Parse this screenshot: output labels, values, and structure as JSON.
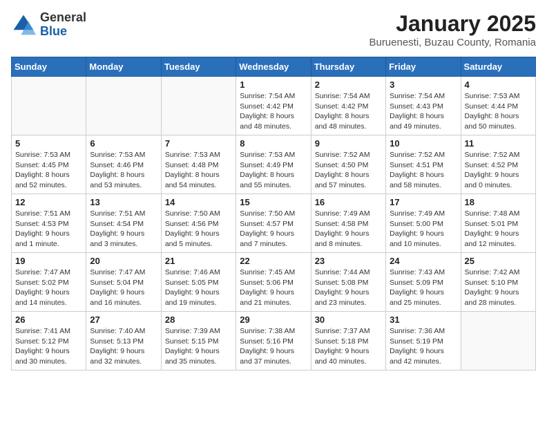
{
  "header": {
    "logo_general": "General",
    "logo_blue": "Blue",
    "month_title": "January 2025",
    "location": "Buruenesti, Buzau County, Romania"
  },
  "weekdays": [
    "Sunday",
    "Monday",
    "Tuesday",
    "Wednesday",
    "Thursday",
    "Friday",
    "Saturday"
  ],
  "weeks": [
    [
      {
        "day": "",
        "info": ""
      },
      {
        "day": "",
        "info": ""
      },
      {
        "day": "",
        "info": ""
      },
      {
        "day": "1",
        "info": "Sunrise: 7:54 AM\nSunset: 4:42 PM\nDaylight: 8 hours\nand 48 minutes."
      },
      {
        "day": "2",
        "info": "Sunrise: 7:54 AM\nSunset: 4:42 PM\nDaylight: 8 hours\nand 48 minutes."
      },
      {
        "day": "3",
        "info": "Sunrise: 7:54 AM\nSunset: 4:43 PM\nDaylight: 8 hours\nand 49 minutes."
      },
      {
        "day": "4",
        "info": "Sunrise: 7:53 AM\nSunset: 4:44 PM\nDaylight: 8 hours\nand 50 minutes."
      }
    ],
    [
      {
        "day": "5",
        "info": "Sunrise: 7:53 AM\nSunset: 4:45 PM\nDaylight: 8 hours\nand 52 minutes."
      },
      {
        "day": "6",
        "info": "Sunrise: 7:53 AM\nSunset: 4:46 PM\nDaylight: 8 hours\nand 53 minutes."
      },
      {
        "day": "7",
        "info": "Sunrise: 7:53 AM\nSunset: 4:48 PM\nDaylight: 8 hours\nand 54 minutes."
      },
      {
        "day": "8",
        "info": "Sunrise: 7:53 AM\nSunset: 4:49 PM\nDaylight: 8 hours\nand 55 minutes."
      },
      {
        "day": "9",
        "info": "Sunrise: 7:52 AM\nSunset: 4:50 PM\nDaylight: 8 hours\nand 57 minutes."
      },
      {
        "day": "10",
        "info": "Sunrise: 7:52 AM\nSunset: 4:51 PM\nDaylight: 8 hours\nand 58 minutes."
      },
      {
        "day": "11",
        "info": "Sunrise: 7:52 AM\nSunset: 4:52 PM\nDaylight: 9 hours\nand 0 minutes."
      }
    ],
    [
      {
        "day": "12",
        "info": "Sunrise: 7:51 AM\nSunset: 4:53 PM\nDaylight: 9 hours\nand 1 minute."
      },
      {
        "day": "13",
        "info": "Sunrise: 7:51 AM\nSunset: 4:54 PM\nDaylight: 9 hours\nand 3 minutes."
      },
      {
        "day": "14",
        "info": "Sunrise: 7:50 AM\nSunset: 4:56 PM\nDaylight: 9 hours\nand 5 minutes."
      },
      {
        "day": "15",
        "info": "Sunrise: 7:50 AM\nSunset: 4:57 PM\nDaylight: 9 hours\nand 7 minutes."
      },
      {
        "day": "16",
        "info": "Sunrise: 7:49 AM\nSunset: 4:58 PM\nDaylight: 9 hours\nand 8 minutes."
      },
      {
        "day": "17",
        "info": "Sunrise: 7:49 AM\nSunset: 5:00 PM\nDaylight: 9 hours\nand 10 minutes."
      },
      {
        "day": "18",
        "info": "Sunrise: 7:48 AM\nSunset: 5:01 PM\nDaylight: 9 hours\nand 12 minutes."
      }
    ],
    [
      {
        "day": "19",
        "info": "Sunrise: 7:47 AM\nSunset: 5:02 PM\nDaylight: 9 hours\nand 14 minutes."
      },
      {
        "day": "20",
        "info": "Sunrise: 7:47 AM\nSunset: 5:04 PM\nDaylight: 9 hours\nand 16 minutes."
      },
      {
        "day": "21",
        "info": "Sunrise: 7:46 AM\nSunset: 5:05 PM\nDaylight: 9 hours\nand 19 minutes."
      },
      {
        "day": "22",
        "info": "Sunrise: 7:45 AM\nSunset: 5:06 PM\nDaylight: 9 hours\nand 21 minutes."
      },
      {
        "day": "23",
        "info": "Sunrise: 7:44 AM\nSunset: 5:08 PM\nDaylight: 9 hours\nand 23 minutes."
      },
      {
        "day": "24",
        "info": "Sunrise: 7:43 AM\nSunset: 5:09 PM\nDaylight: 9 hours\nand 25 minutes."
      },
      {
        "day": "25",
        "info": "Sunrise: 7:42 AM\nSunset: 5:10 PM\nDaylight: 9 hours\nand 28 minutes."
      }
    ],
    [
      {
        "day": "26",
        "info": "Sunrise: 7:41 AM\nSunset: 5:12 PM\nDaylight: 9 hours\nand 30 minutes."
      },
      {
        "day": "27",
        "info": "Sunrise: 7:40 AM\nSunset: 5:13 PM\nDaylight: 9 hours\nand 32 minutes."
      },
      {
        "day": "28",
        "info": "Sunrise: 7:39 AM\nSunset: 5:15 PM\nDaylight: 9 hours\nand 35 minutes."
      },
      {
        "day": "29",
        "info": "Sunrise: 7:38 AM\nSunset: 5:16 PM\nDaylight: 9 hours\nand 37 minutes."
      },
      {
        "day": "30",
        "info": "Sunrise: 7:37 AM\nSunset: 5:18 PM\nDaylight: 9 hours\nand 40 minutes."
      },
      {
        "day": "31",
        "info": "Sunrise: 7:36 AM\nSunset: 5:19 PM\nDaylight: 9 hours\nand 42 minutes."
      },
      {
        "day": "",
        "info": ""
      }
    ]
  ]
}
